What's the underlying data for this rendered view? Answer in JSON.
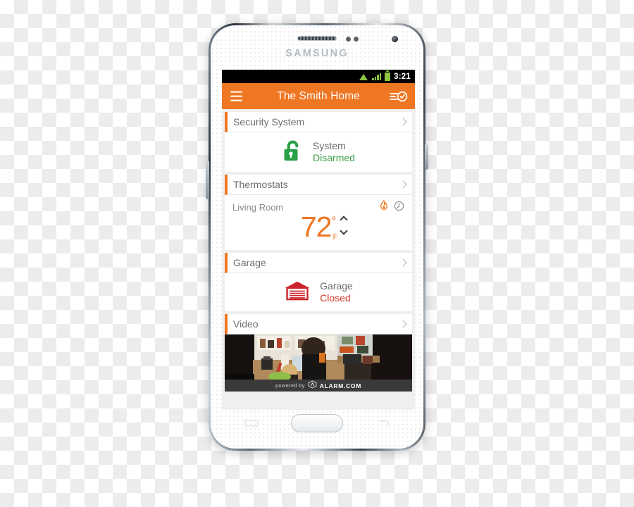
{
  "device": {
    "brand": "SAMSUNG",
    "hardware": {
      "earpiece": "earpiece-speaker",
      "front_camera": "front-camera",
      "proximity_sensor": "proximity-sensor",
      "home_button": "home-button",
      "recents_key": "recent-apps-key",
      "back_key": "back-key"
    }
  },
  "statusbar": {
    "wifi_icon": "wifi-icon",
    "signal_icon": "cellular-signal-icon",
    "battery_icon": "battery-icon",
    "time": "3:21"
  },
  "appbar": {
    "menu_icon": "hamburger-menu-icon",
    "title": "The Smith Home",
    "action_icon": "activity-checklist-icon"
  },
  "cards": [
    {
      "id": "security-system",
      "title": "Security System",
      "chevron": "chevron-right-icon",
      "icon": "unlocked-padlock-icon",
      "label": "System",
      "status": "Disarmed",
      "status_color": "#3fa34a"
    },
    {
      "id": "thermostats",
      "title": "Thermostats",
      "chevron": "chevron-right-icon",
      "room": "Living Room",
      "mode_icon": "flame-heat-icon",
      "schedule_icon": "clock-schedule-icon",
      "temperature": "72",
      "degree": "°",
      "unit": "F",
      "temp_color": "#ef7622",
      "up_icon": "chevron-up-icon",
      "down_icon": "chevron-down-icon"
    },
    {
      "id": "garage",
      "title": "Garage",
      "chevron": "chevron-right-icon",
      "icon": "garage-door-icon",
      "label": "Garage",
      "status": "Closed",
      "status_color": "#d6372b"
    },
    {
      "id": "video",
      "title": "Video",
      "chevron": "chevron-right-icon",
      "thumbnail": "kitchen-camera-feed"
    }
  ],
  "brandbar": {
    "powered_by": "powered by",
    "logo_icon": "alarm-com-hexagon-logo",
    "name": "ALARM.COM"
  },
  "theme": {
    "accent_orange": "#ef7622",
    "green": "#3fa34a",
    "red": "#d6372b",
    "header_text": "#ffffff",
    "card_bg": "#ffffff",
    "screen_bg": "#efefef"
  }
}
